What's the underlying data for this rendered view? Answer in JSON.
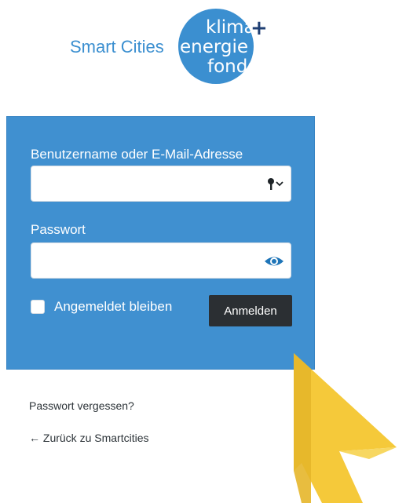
{
  "logo": {
    "text": "Smart Cities",
    "badge_line1": "klima",
    "badge_line2": "energie",
    "badge_line3": "fonds",
    "badge_plus": "+",
    "brand_color": "#3b8fd0"
  },
  "login_form": {
    "username_label": "Benutzername oder E-Mail-Adresse",
    "username_value": "",
    "username_icon": "key-icon",
    "password_label": "Passwort",
    "password_value": "",
    "password_icon": "eye-icon",
    "remember_label": "Angemeldet bleiben",
    "remember_checked": false,
    "submit_label": "Anmelden",
    "panel_color": "#4090d0"
  },
  "links": {
    "lost_password": "Passwort vergessen?",
    "back_to_site": "← Zurück zu Smartcities"
  },
  "overlay": {
    "cursor_icon": "pointer-cursor-icon",
    "cursor_color": "#f5c93a"
  }
}
